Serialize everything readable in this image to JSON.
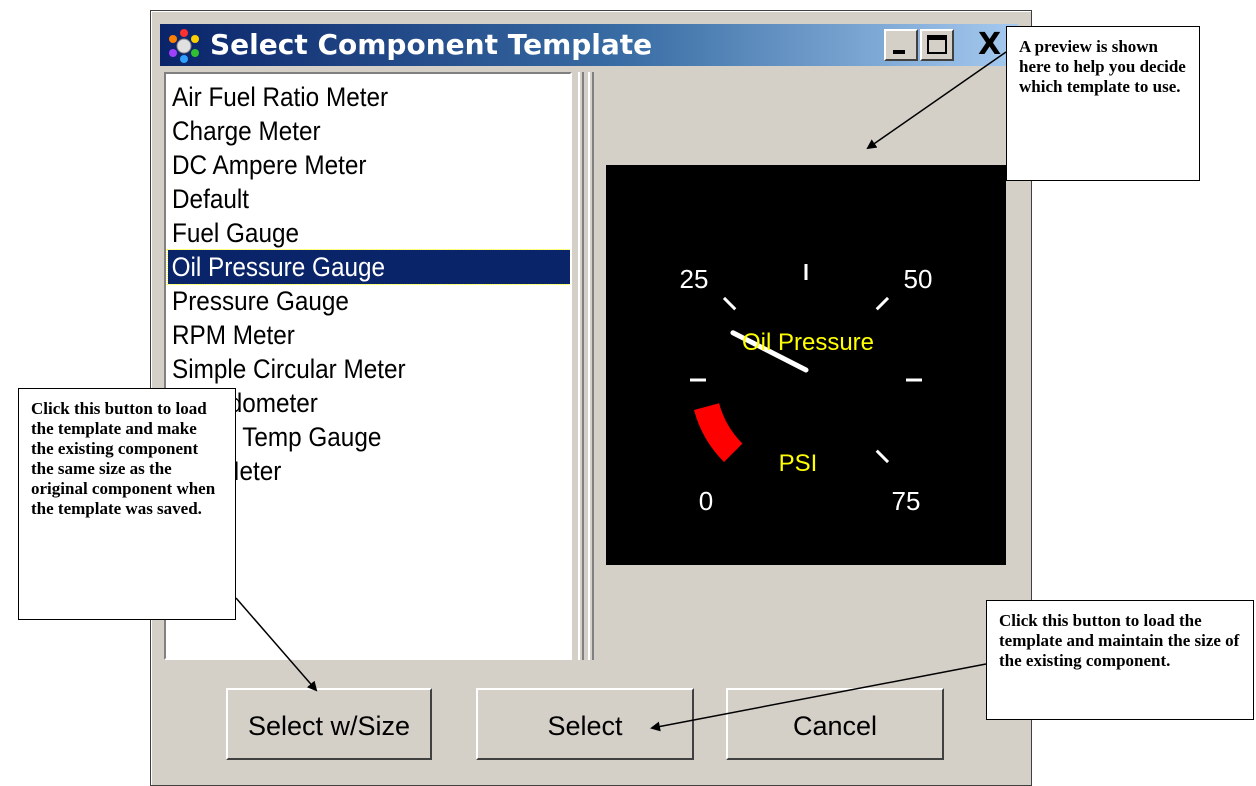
{
  "window": {
    "title": "Select Component Template",
    "close_glyph": "X"
  },
  "template_list": {
    "items": [
      "Air Fuel Ratio Meter",
      "Charge Meter",
      "DC Ampere Meter",
      "Default",
      "Fuel Gauge",
      "Oil Pressure Gauge",
      "Pressure Gauge",
      "RPM Meter",
      "Simple Circular Meter",
      "Speedometer",
      "Water Temp Gauge",
      "Volt Meter"
    ],
    "selected": "Oil Pressure Gauge"
  },
  "preview": {
    "gauge_label": "Oil Pressure",
    "unit_label": "PSI",
    "scale": [
      "0",
      "25",
      "50",
      "75"
    ],
    "needle_value": 20,
    "colors": {
      "background": "#000000",
      "label": "#ffff00",
      "ticks": "#ffffff",
      "red_zone": "#ff0000"
    }
  },
  "buttons": {
    "select_w_size": "Select w/Size",
    "select": "Select",
    "cancel": "Cancel"
  },
  "callouts": {
    "preview": "A preview is shown here to help you decide which template to use.",
    "select_w_size": "Click this button to load the template and make the existing component the same size as the original component when the template was saved.",
    "select": "Click this button to load the template and maintain the size of the existing component."
  },
  "colors": {
    "selection": "#0a246a",
    "dialog_face": "#d4d0c8"
  }
}
